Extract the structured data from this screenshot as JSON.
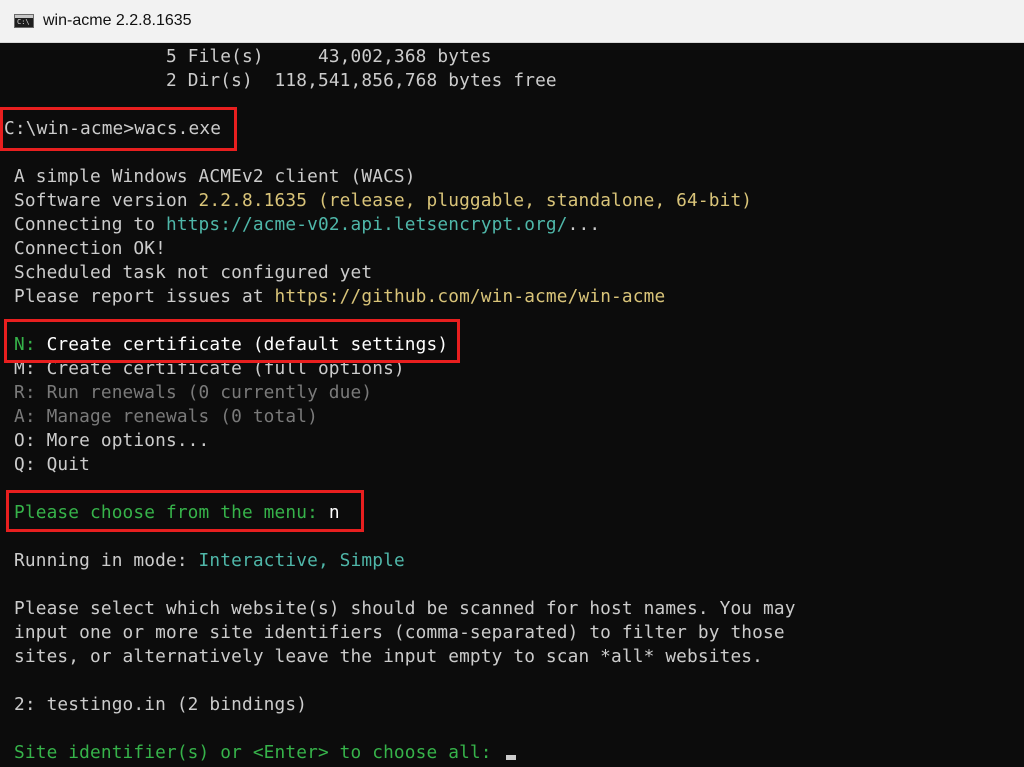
{
  "window": {
    "title": "win-acme 2.2.8.1635",
    "icon": "console-icon",
    "icon_text": "C:\\"
  },
  "console": {
    "dir_files": "5 File(s)     43,002,368 bytes",
    "dir_dirs": "2 Dir(s)  118,541,856,768 bytes free",
    "command": "C:\\win-acme>wacs.exe",
    "banner": "A simple Windows ACMEv2 client (WACS)",
    "version_prefix": "Software version ",
    "version_value": "2.2.8.1635 (release, pluggable, standalone, 64-bit)",
    "connecting_prefix": "Connecting to ",
    "connecting_url": "https://acme-v02.api.letsencrypt.org/",
    "connecting_suffix": "...",
    "connection_ok": "Connection OK!",
    "scheduled_task": "Scheduled task not configured yet",
    "report_prefix": "Please report issues at ",
    "report_url": "https://github.com/win-acme/win-acme",
    "menu": {
      "n_key": "N:",
      "n_text": " Create certificate (default settings)",
      "m_item": "M: Create certificate (full options)",
      "r_item": "R: Run renewals (0 currently due)",
      "a_item": "A: Manage renewals (0 total)",
      "o_item": "O: More options...",
      "q_item": "Q: Quit"
    },
    "prompt_text": "Please choose from the menu: ",
    "prompt_answer": "n",
    "mode_prefix": "Running in mode: ",
    "mode_value": "Interactive, Simple",
    "select_line1": "Please select which website(s) should be scanned for host names. You may",
    "select_line2": "input one or more site identifiers (comma-separated) to filter by those",
    "select_line3": "sites, or alternatively leave the input empty to scan *all* websites.",
    "site_entry": "2: testingo.in (2 bindings)",
    "site_prompt": "Site identifier(s) or <Enter> to choose all: "
  },
  "colors": {
    "highlight_box": "#e81f1f",
    "prompt_green": "#36b34a",
    "value_yellow": "#d9c479",
    "url_cyan": "#4fb7a9",
    "disabled_gray": "#7a7a7a"
  }
}
